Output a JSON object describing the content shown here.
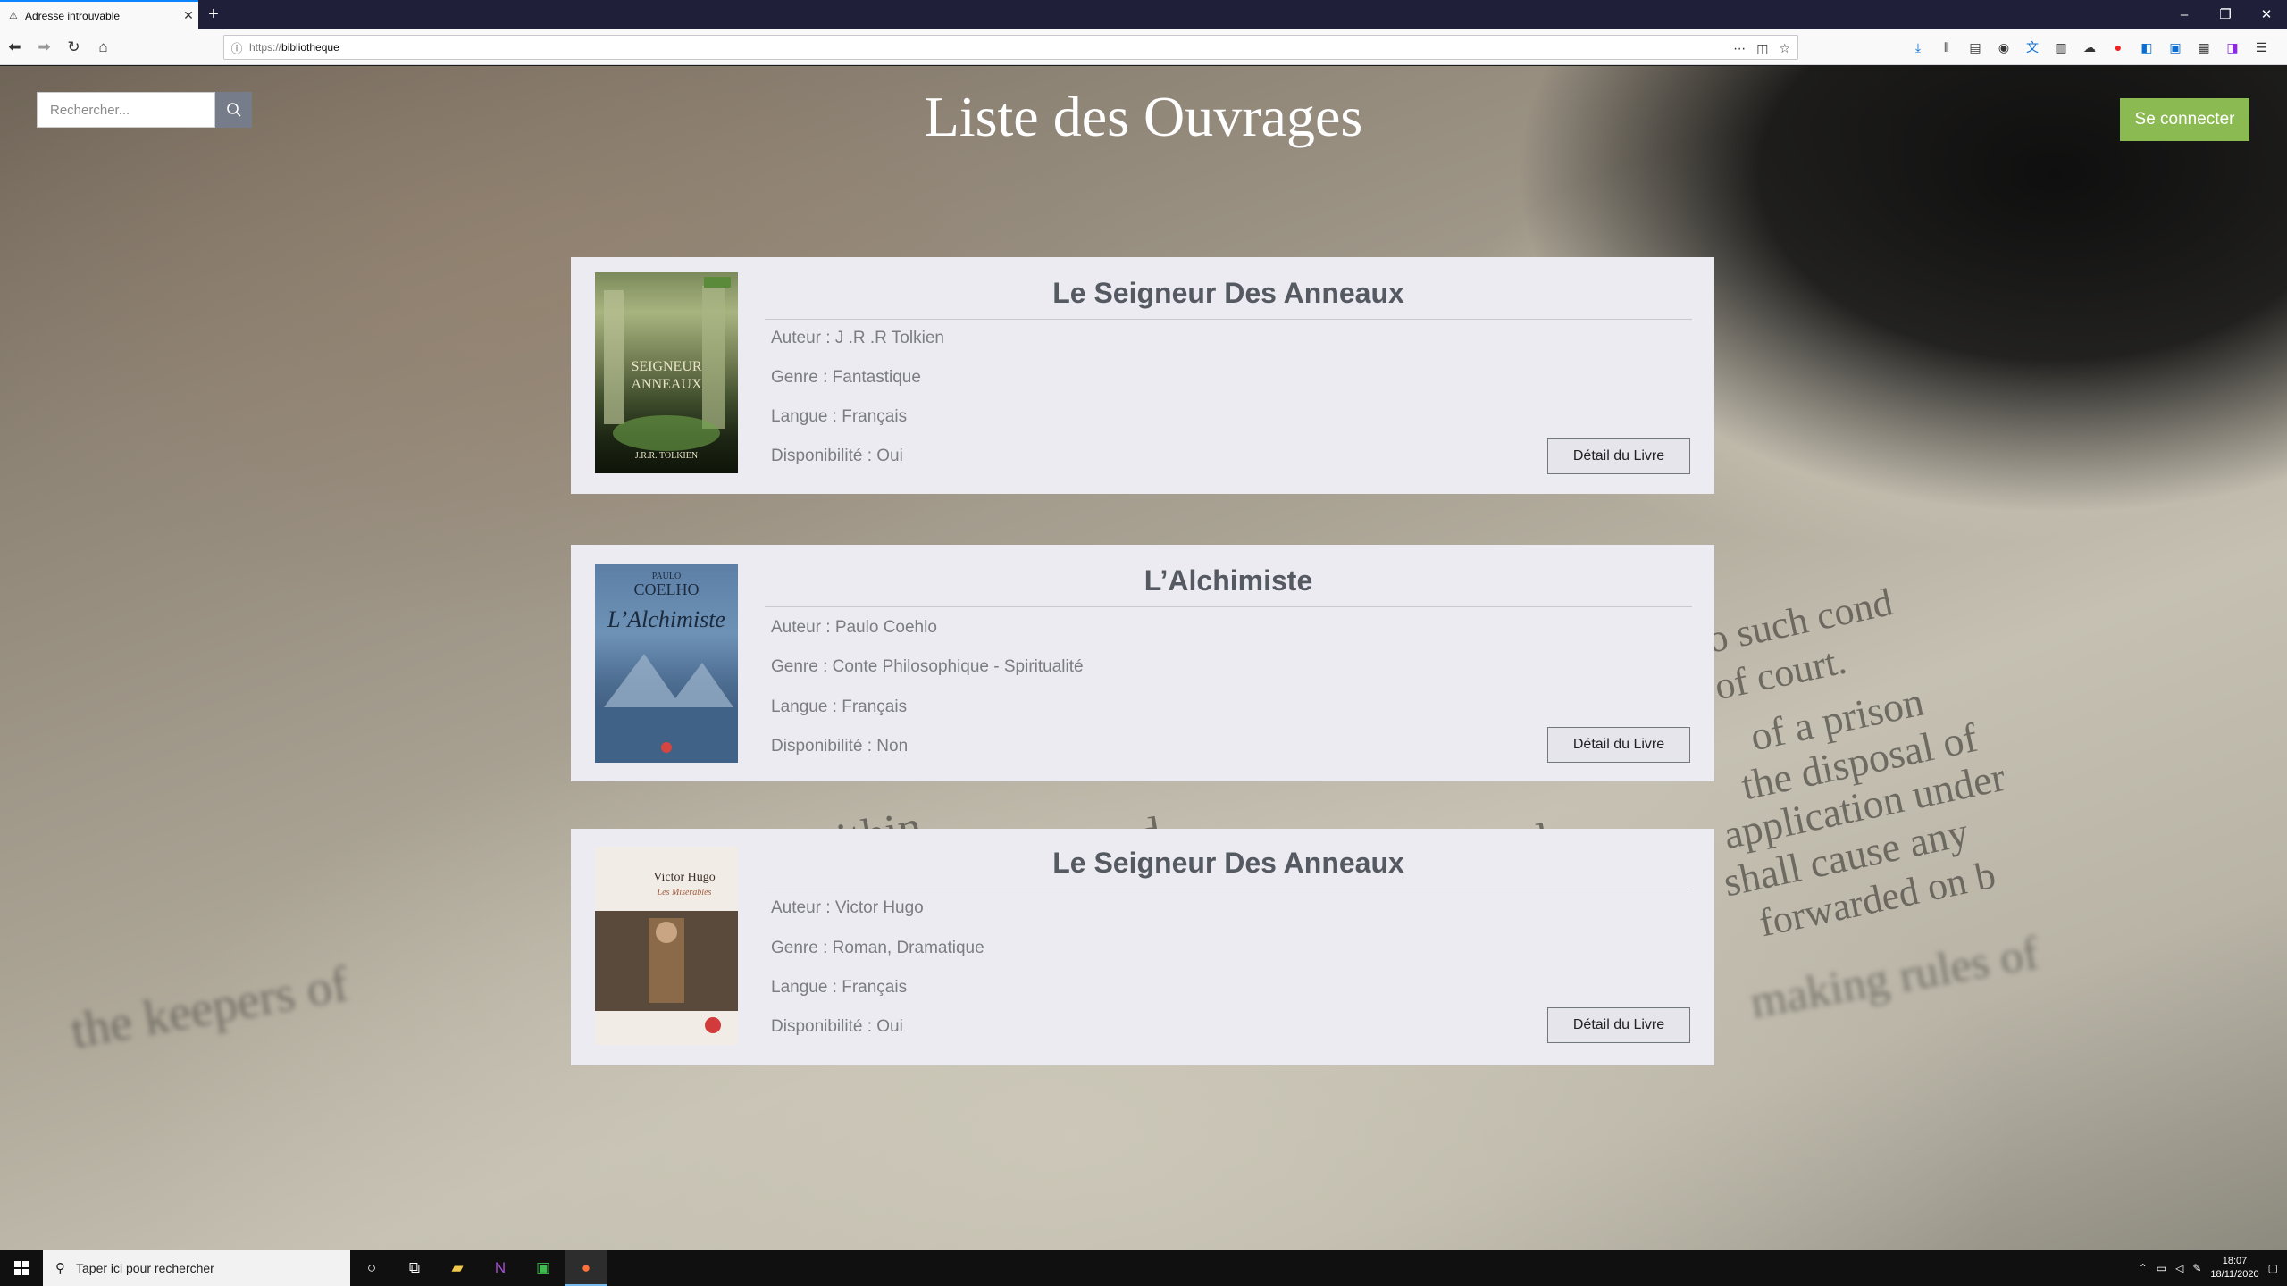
{
  "browser": {
    "tab_title": "Adresse introuvable",
    "tab_close": "✕",
    "new_tab": "+",
    "url_protocol": "https://",
    "url_host": "bibliotheque",
    "window_controls": [
      "–",
      "❐",
      "✕"
    ]
  },
  "header": {
    "search_placeholder": "Rechercher...",
    "title": "Liste des Ouvrages",
    "login_label": "Se connecter"
  },
  "books": [
    {
      "title": "Le Seigneur Des Anneaux",
      "author": "Auteur : J .R .R Tolkien",
      "genre": "Genre : Fantastique",
      "language": "Langue : Français",
      "availability": "Disponibilité : Oui",
      "detail_label": "Détail du Livre",
      "cover_text": [
        "SEIGNEUR",
        "ANNEAUX",
        "J.R.R. TOLKIEN"
      ]
    },
    {
      "title": "L’Alchimiste",
      "author": "Auteur : Paulo Coehlo",
      "genre": "Genre : Conte Philosophique - Spiritualité",
      "language": "Langue : Français",
      "availability": "Disponibilité : Non",
      "detail_label": "Détail du Livre",
      "cover_text": [
        "PAULO",
        "COELHO",
        "L’Alchimiste"
      ]
    },
    {
      "title": "Le Seigneur Des Anneaux",
      "author": "Auteur : Victor Hugo",
      "genre": "Genre : Roman, Dramatique",
      "language": "Langue : Français",
      "availability": "Disponibilité : Oui",
      "detail_label": "Détail du Livre",
      "cover_text": [
        "Victor Hugo",
        "Les Misérables"
      ]
    }
  ],
  "taskbar": {
    "search_text": "Taper ici pour rechercher",
    "time": "18:07",
    "date": "18/11/2020"
  },
  "background_text": [
    "to such cond",
    "of court.",
    "of a prison",
    "the disposal of",
    "application under",
    "shall cause any",
    "forwarded on b",
    "within",
    "stated",
    "placed",
    "the keepers of",
    "making rules of"
  ],
  "colors": {
    "card_bg": "#ecebf1",
    "login_green": "#8cba52",
    "search_button": "#767c8a",
    "title_text": "#ffffff"
  }
}
